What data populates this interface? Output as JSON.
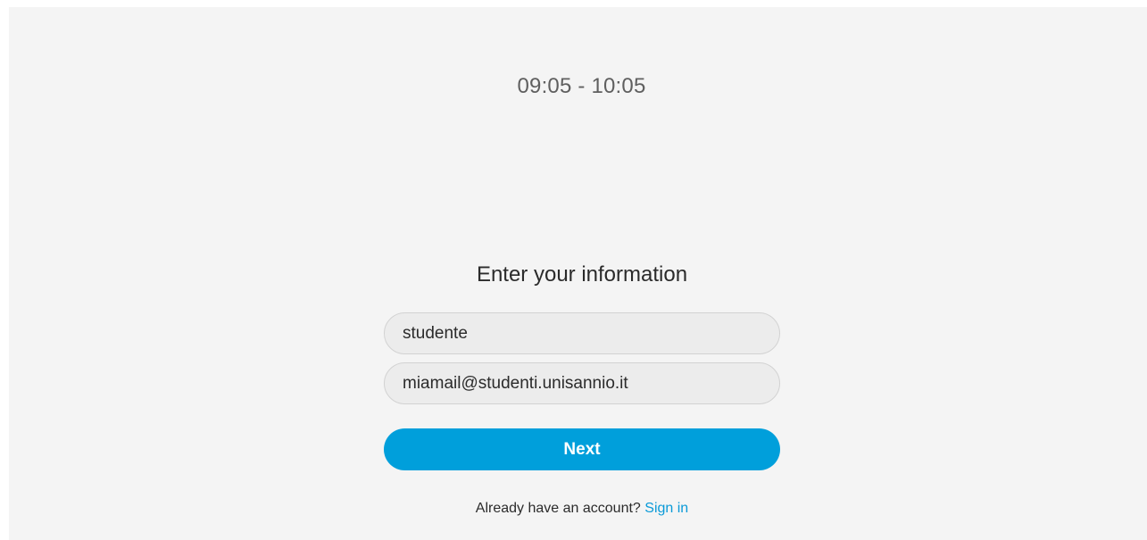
{
  "meeting": {
    "time_range": "09:05 - 10:05"
  },
  "form": {
    "title": "Enter your information",
    "name_value": "studente",
    "email_value": "miamail@studenti.unisannio.it",
    "next_label": "Next"
  },
  "signin": {
    "prompt": "Already have an account?",
    "link_label": "Sign in"
  },
  "colors": {
    "accent": "#009fdb",
    "link": "#0a9ad8",
    "page_background": "#f4f4f4"
  }
}
